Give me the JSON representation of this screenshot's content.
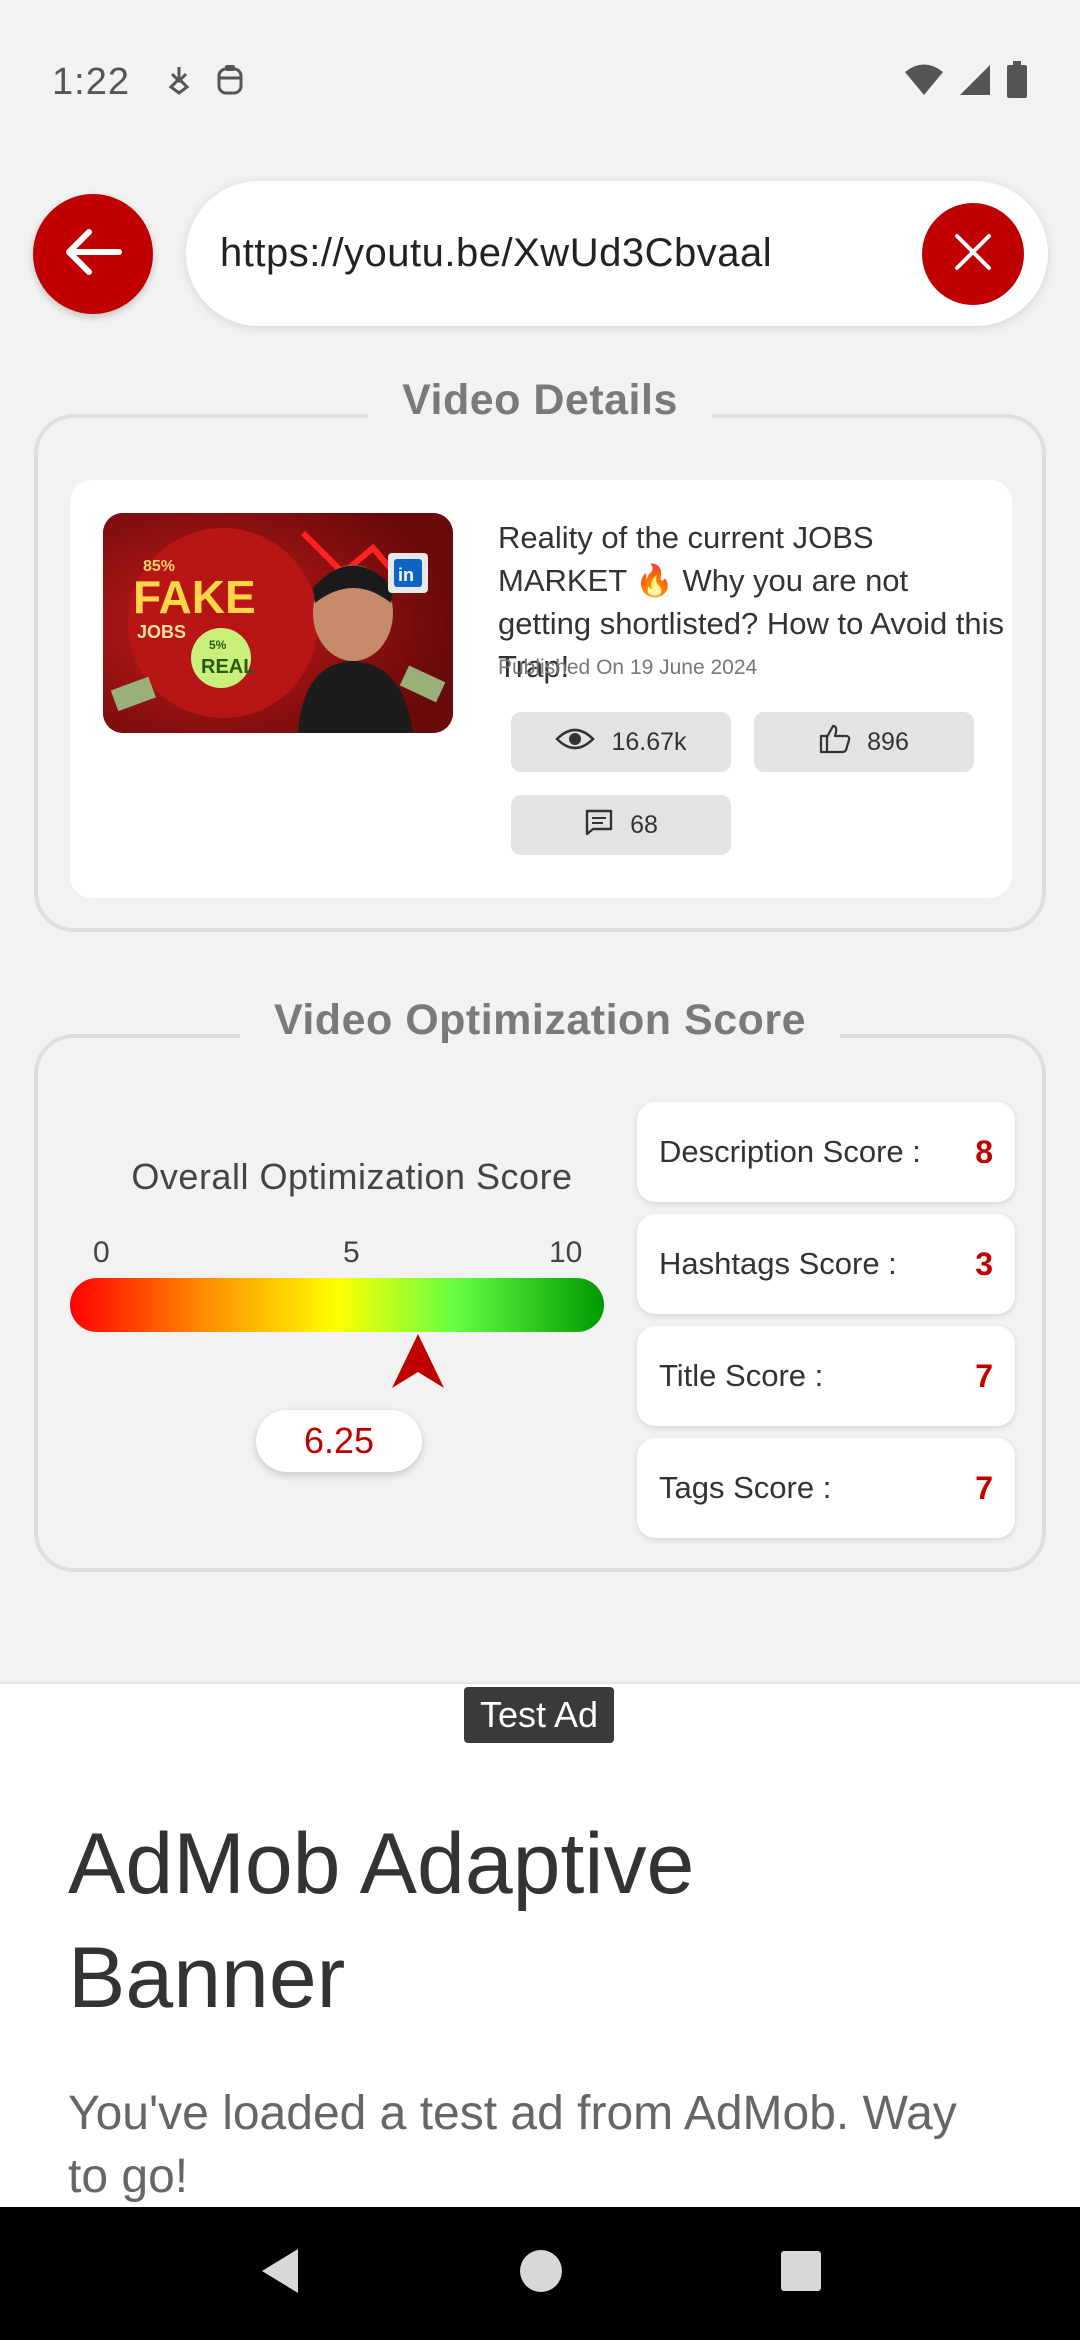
{
  "status_bar": {
    "time": "1:22",
    "icons": [
      "download-indicator-icon",
      "privacy-indicator-icon",
      "wifi-icon",
      "cellular-signal-icon",
      "battery-icon"
    ]
  },
  "url_bar": {
    "back_icon": "arrow-left-icon",
    "url": "https://youtu.be/XwUd3Cbvaal",
    "clear_icon": "close-icon"
  },
  "video_details": {
    "section_title": "Video Details",
    "thumbnail": {
      "text_fake": "FAKE",
      "text_jobs": "JOBS",
      "text_pct_top": "85%",
      "text_pct_badge": "5%",
      "text_real": "REAL",
      "badge": "in"
    },
    "title": "Reality of the current JOBS MARKET 🔥 Why you are not getting shortlisted? How to Avoid this Trap!",
    "published": "Published On 19 June 2024",
    "stats": {
      "views": "16.67k",
      "likes": "896",
      "comments": "68"
    }
  },
  "optimization": {
    "section_title": "Video Optimization Score",
    "overall_label": "Overall Optimization Score",
    "scale": {
      "min": "0",
      "mid": "5",
      "max": "10"
    },
    "overall_score": "6.25",
    "overall_score_fraction": 0.625,
    "scores": [
      {
        "label": "Description Score :",
        "value": "8"
      },
      {
        "label": "Hashtags Score :",
        "value": "3"
      },
      {
        "label": "Title Score :",
        "value": "7"
      },
      {
        "label": "Tags Score :",
        "value": "7"
      }
    ],
    "colors": {
      "accent": "#c00000",
      "gradient": [
        "#ff0000",
        "#ffff00",
        "#009900"
      ]
    }
  },
  "ad": {
    "badge": "Test Ad",
    "title": "AdMob Adaptive Banner",
    "subtitle": "You've loaded a test ad from AdMob. Way to go!"
  },
  "nav_bar": {
    "icons": [
      "back-triangle-icon",
      "home-circle-icon",
      "recents-square-icon"
    ]
  }
}
